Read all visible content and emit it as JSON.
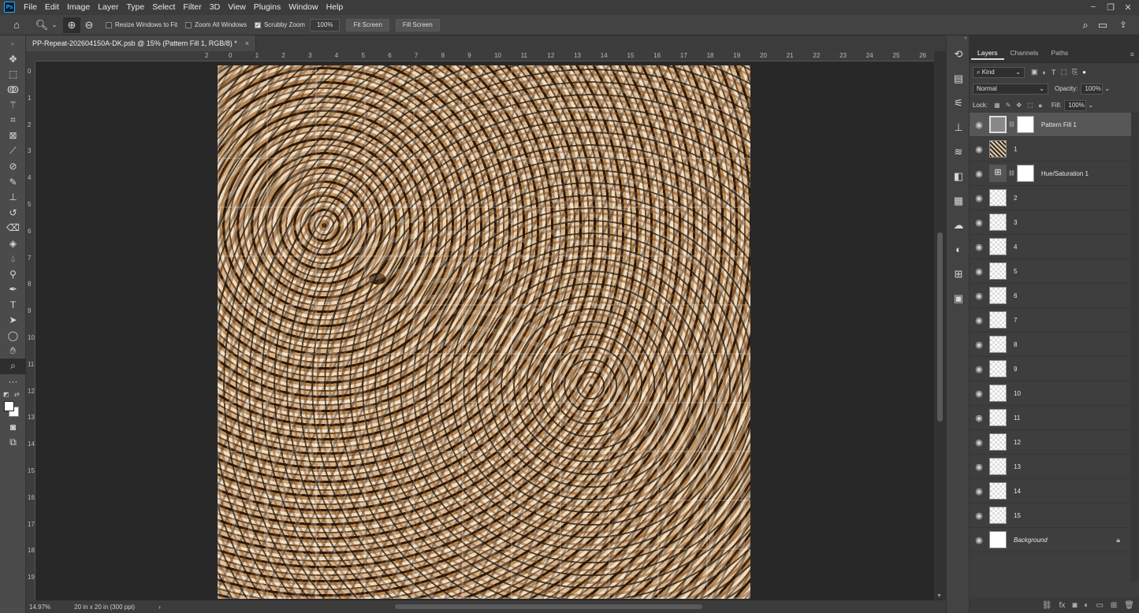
{
  "menubar": {
    "logo": "Ps",
    "items": [
      "File",
      "Edit",
      "Image",
      "Layer",
      "Type",
      "Select",
      "Filter",
      "3D",
      "View",
      "Plugins",
      "Window",
      "Help"
    ]
  },
  "window_controls": [
    "−",
    "❐",
    "✕"
  ],
  "options": {
    "resize_windows": "Resize Windows to Fit",
    "zoom_all": "Zoom All Windows",
    "scrubby_zoom": "Scrubby Zoom",
    "scrubby_checked": true,
    "zoom_value": "100%",
    "fit_screen": "Fit Screen",
    "fill_screen": "Fill Screen"
  },
  "document": {
    "tab_title": "PP-Repeat-202604150A-DK.psb @ 15% (Pattern Fill 1, RGB/8) *",
    "close": "×"
  },
  "status": {
    "zoom": "14.97%",
    "doc_info": "20 in x 20 in (300 ppi)",
    "arrow": "›"
  },
  "ruler_h": [
    "2",
    "0",
    "1",
    "2",
    "3",
    "4",
    "5",
    "6",
    "7",
    "8",
    "9",
    "10",
    "11",
    "12",
    "13",
    "14",
    "15",
    "16",
    "17",
    "18",
    "19",
    "20",
    "21",
    "22",
    "23",
    "24",
    "25",
    "26"
  ],
  "ruler_v": [
    "0",
    "1",
    "2",
    "3",
    "4",
    "5",
    "6",
    "7",
    "8",
    "9",
    "10",
    "11",
    "12",
    "13",
    "14",
    "15",
    "16",
    "17",
    "18",
    "19"
  ],
  "layers_panel": {
    "tabs": [
      "Layers",
      "Channels",
      "Paths"
    ],
    "active_tab": "Layers",
    "filter_kind": "Kind",
    "blend_mode": "Normal",
    "opacity_label": "Opacity:",
    "opacity_value": "100%",
    "lock_label": "Lock:",
    "fill_label": "Fill:",
    "fill_value": "100%",
    "layers": [
      {
        "name": "Pattern Fill 1",
        "selected": true,
        "mask": true
      },
      {
        "name": "1",
        "selected": false,
        "mask": false
      },
      {
        "name": "Hue/Saturation 1",
        "selected": false,
        "mask": true
      },
      {
        "name": "2"
      },
      {
        "name": "3"
      },
      {
        "name": "4"
      },
      {
        "name": "5"
      },
      {
        "name": "6"
      },
      {
        "name": "7"
      },
      {
        "name": "8"
      },
      {
        "name": "9"
      },
      {
        "name": "10"
      },
      {
        "name": "11"
      },
      {
        "name": "12"
      },
      {
        "name": "13"
      },
      {
        "name": "14"
      },
      {
        "name": "15"
      },
      {
        "name": "Background",
        "locked": true
      }
    ]
  }
}
